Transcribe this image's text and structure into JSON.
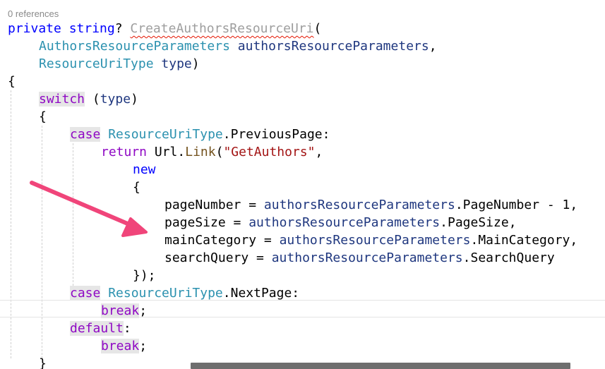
{
  "codelens": {
    "references": "0 references"
  },
  "code": {
    "line1": {
      "private": "private",
      "string": "string",
      "q": "?",
      "method": "CreateAuthorsResourceUri",
      "paren": "("
    },
    "line2": {
      "type": "AuthorsResourceParameters",
      "param": "authorsResourceParameters",
      "comma": ","
    },
    "line3": {
      "type": "ResourceUriType",
      "param": "type",
      "paren": ")"
    },
    "line4": {
      "brace": "{"
    },
    "line5": {
      "switch": "switch",
      "open": "(",
      "param": "type",
      "close": ")"
    },
    "line6": {
      "brace": "{"
    },
    "line7": {
      "case": "case",
      "type": "ResourceUriType",
      "member": ".PreviousPage:"
    },
    "line8": {
      "return": "return",
      "url": "Url.",
      "method": "Link",
      "paren": "(",
      "str": "\"GetAuthors\"",
      "comma": ","
    },
    "line9": {
      "new": "new"
    },
    "line10": {
      "brace": "{"
    },
    "line11": {
      "lhs": "pageNumber = ",
      "param": "authorsResourceParameters",
      "rhs": ".PageNumber - 1,"
    },
    "line12": {
      "lhs": "pageSize = ",
      "param": "authorsResourceParameters",
      "rhs": ".PageSize,"
    },
    "line13": {
      "lhs": "mainCategory = ",
      "param": "authorsResourceParameters",
      "rhs": ".MainCategory,"
    },
    "line14": {
      "lhs": "searchQuery = ",
      "param": "authorsResourceParameters",
      "rhs": ".SearchQuery"
    },
    "line15": {
      "close": "});"
    },
    "line16": {
      "case": "case",
      "type": "ResourceUriType",
      "member": ".NextPage:"
    },
    "line17": {
      "break": "break",
      "semi": ";"
    },
    "line18": {
      "default": "default",
      "colon": ":"
    },
    "line19": {
      "break": "break",
      "semi": ";"
    },
    "line20": {
      "brace": "}"
    }
  },
  "colors": {
    "keyword": "#0000ff",
    "control_keyword": "#8f08c4",
    "type": "#2b91af",
    "parameter": "#1f377f",
    "string": "#a31515",
    "annotation_arrow": "#f0457a"
  },
  "icons": {
    "annotation": "arrow-annotation-icon"
  }
}
